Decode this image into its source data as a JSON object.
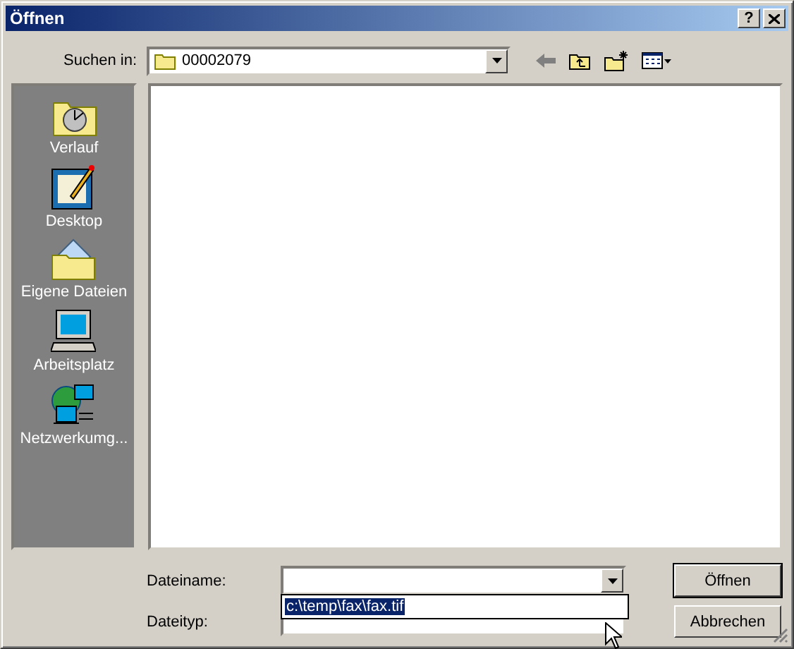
{
  "window": {
    "title": "Öffnen",
    "help_button": "?"
  },
  "look_in": {
    "label": "Suchen in:",
    "value": "00002079"
  },
  "places": [
    {
      "label": "Verlauf",
      "kind": "history"
    },
    {
      "label": "Desktop",
      "kind": "desktop"
    },
    {
      "label": "Eigene Dateien",
      "kind": "documents"
    },
    {
      "label": "Arbeitsplatz",
      "kind": "computer"
    },
    {
      "label": "Netzwerkumg...",
      "kind": "network"
    }
  ],
  "file_name": {
    "label": "Dateiname:"
  },
  "file_type": {
    "label": "Dateityp:"
  },
  "autocomplete": [
    {
      "text": "c:\\temp\\fax\\fax.tif",
      "selected": true
    }
  ],
  "buttons": [
    {
      "label": "Öffnen",
      "default": true
    },
    {
      "label": "Abbrechen",
      "default": false
    }
  ]
}
